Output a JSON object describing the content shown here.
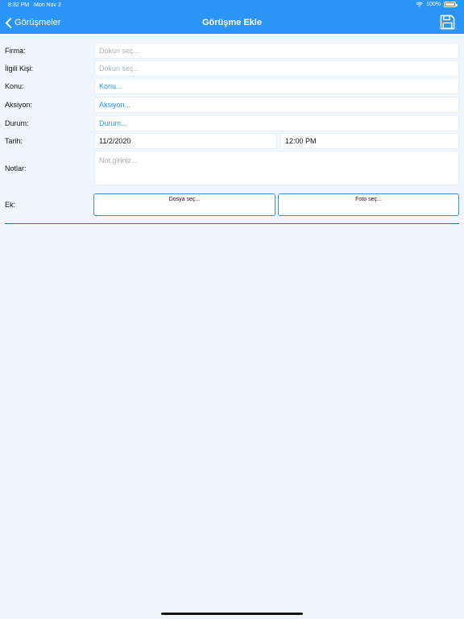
{
  "status_bar": {
    "time": "8:32 PM",
    "date": "Mon Nov 2",
    "battery": "100%",
    "battery_level": 1.0
  },
  "nav": {
    "back_label": "Görüşmeler",
    "title": "Görüşme Ekle",
    "back_icon": "chevron-left-icon",
    "save_icon": "floppy-disk-icon"
  },
  "form": {
    "firma": {
      "label": "Firma:",
      "placeholder": "Dokun seç..."
    },
    "ilgili_kisi": {
      "label": "İlgili Kişi:",
      "placeholder": "Dokun seç..."
    },
    "konu": {
      "label": "Konu:",
      "value": "Konu..."
    },
    "aksiyon": {
      "label": "Aksiyon:",
      "value": "Aksiyon..."
    },
    "durum": {
      "label": "Durum:",
      "value": "Durum..."
    },
    "tarih": {
      "label": "Tarih:",
      "date": "11/2/2020",
      "time": "12:00 PM"
    },
    "notlar": {
      "label": "Notlar:",
      "placeholder": "Not giriniz..."
    },
    "ek": {
      "label": "Ek:",
      "file_button": "Dosya seç...",
      "photo_button": "Foto seç..."
    }
  },
  "colors": {
    "accent": "#2b95f5",
    "background": "#eff6fd",
    "divider": "#1d7fa9"
  }
}
